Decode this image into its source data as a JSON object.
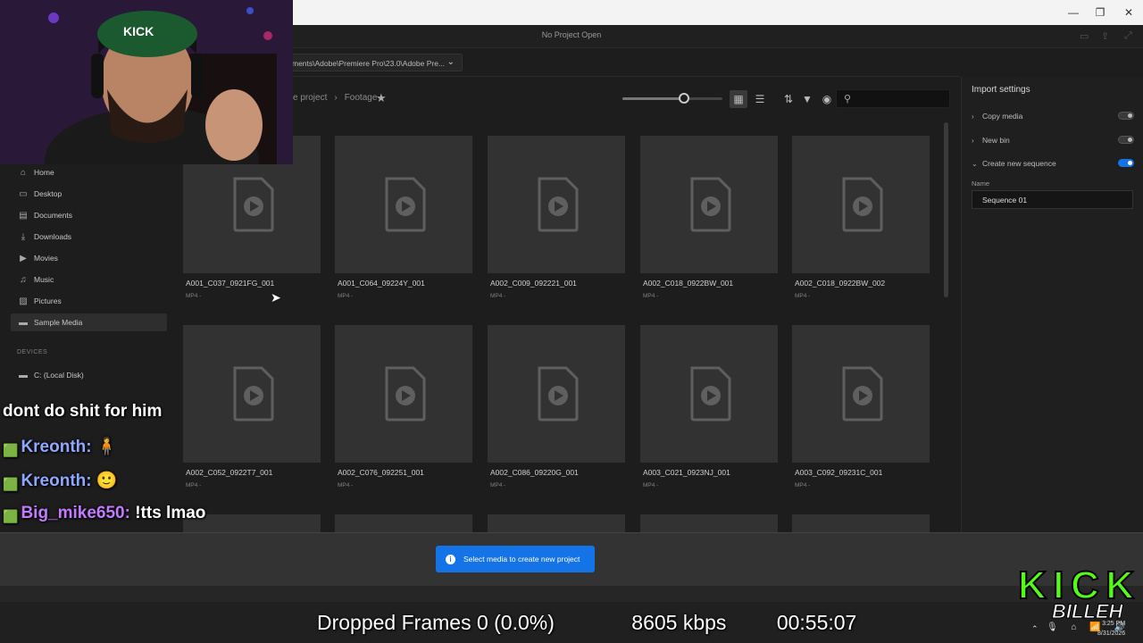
{
  "window": {
    "title": "No Project Open"
  },
  "path": {
    "value": "ments\\Adobe\\Premiere Pro\\23.0\\Adobe Pre..."
  },
  "breadcrumb": {
    "parent": "e project",
    "separator": "›",
    "current": "Footage"
  },
  "sidebar": {
    "items": [
      {
        "label": "Home",
        "icon": "home-icon",
        "glyph": "⌂"
      },
      {
        "label": "Desktop",
        "icon": "monitor-icon",
        "glyph": "▭"
      },
      {
        "label": "Documents",
        "icon": "document-icon",
        "glyph": "▤"
      },
      {
        "label": "Downloads",
        "icon": "download-icon",
        "glyph": "⤓"
      },
      {
        "label": "Movies",
        "icon": "video-camera-icon",
        "glyph": "▶"
      },
      {
        "label": "Music",
        "icon": "music-note-icon",
        "glyph": "♫"
      },
      {
        "label": "Pictures",
        "icon": "image-icon",
        "glyph": "▨"
      },
      {
        "label": "Sample Media",
        "icon": "folder-icon",
        "glyph": "▬",
        "selected": true
      }
    ],
    "devices_heading": "DEVICES",
    "devices": [
      {
        "label": "C: (Local Disk)",
        "icon": "folder-icon"
      }
    ]
  },
  "media": [
    {
      "name": "A001_C037_0921FG_001",
      "type": "MP4 -"
    },
    {
      "name": "A001_C064_09224Y_001",
      "type": "MP4 -"
    },
    {
      "name": "A002_C009_092221_001",
      "type": "MP4 -"
    },
    {
      "name": "A002_C018_0922BW_001",
      "type": "MP4 -"
    },
    {
      "name": "A002_C018_0922BW_002",
      "type": "MP4 -"
    },
    {
      "name": "A002_C052_0922T7_001",
      "type": "MP4 -"
    },
    {
      "name": "A002_C076_092251_001",
      "type": "MP4 -"
    },
    {
      "name": "A002_C086_09220G_001",
      "type": "MP4 -"
    },
    {
      "name": "A003_C021_0923NJ_001",
      "type": "MP4 -"
    },
    {
      "name": "A003_C092_09231C_001",
      "type": "MP4 -"
    }
  ],
  "import_settings": {
    "title": "Import settings",
    "copy_media": {
      "label": "Copy media",
      "on": false
    },
    "new_bin": {
      "label": "New bin",
      "on": false
    },
    "create_sequence": {
      "label": "Create new sequence",
      "on": true
    },
    "name_label": "Name",
    "name_value": "Sequence 01"
  },
  "toast": {
    "message": "Select media to create new project",
    "icon": "info-icon"
  },
  "chat": [
    {
      "text": "dont do shit for him"
    },
    {
      "user": "Kreonth:",
      "message": ""
    },
    {
      "user": "Kreonth:",
      "message": ""
    },
    {
      "user": "Big_mike650:",
      "message": "!tts lmao"
    }
  ],
  "stats": {
    "dropped_frames": "Dropped Frames 0 (0.0%)",
    "bitrate": "8605 kbps",
    "uptime": "00:55:07"
  },
  "taskbar": {
    "search_placeholder": "Search",
    "date": "8/31/2026",
    "time": "3:25 PM"
  },
  "colors": {
    "accent": "#1473e6",
    "card": "#323232",
    "panel": "#1f1f1f"
  }
}
